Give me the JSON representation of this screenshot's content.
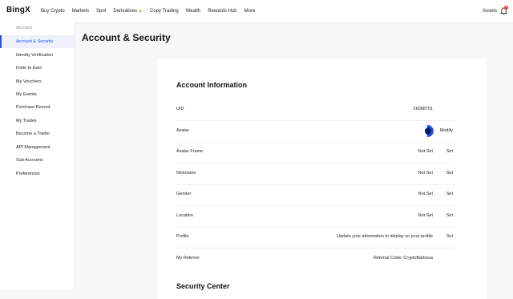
{
  "brand": {
    "logo_text": "BingX"
  },
  "nav": {
    "items": [
      "Buy Crypto",
      "Markets",
      "Spot",
      "Derivatives",
      "Copy Trading",
      "Wealth",
      "Rewards Hub",
      "More"
    ],
    "assets": "Assets",
    "notification_count": "1"
  },
  "sidebar": {
    "heading": "Account",
    "items": [
      "Account & Security",
      "Identity Verification",
      "Invite to Earn",
      "My Vouchers",
      "My Events",
      "Purchase Record",
      "My Trades",
      "Become a Trader",
      "API Management",
      "Sub Accounts",
      "Preferences"
    ],
    "active_index": 0
  },
  "page": {
    "title": "Account & Security"
  },
  "account_info": {
    "title": "Account Information",
    "rows": [
      {
        "label": "UID",
        "value": "26088701",
        "action": ""
      },
      {
        "label": "Avatar",
        "value": "",
        "action": "Modify"
      },
      {
        "label": "Avatar Frame",
        "value": "Not Set",
        "action": "Set"
      },
      {
        "label": "Nickname",
        "value": "Not Set",
        "action": "Set"
      },
      {
        "label": "Gender",
        "value": "Not Set",
        "action": "Set"
      },
      {
        "label": "Location",
        "value": "Not Set",
        "action": "Set"
      },
      {
        "label": "Profile",
        "value": "Update your information to display on your profile",
        "action": "Set"
      },
      {
        "label": "My Referrer",
        "value": "Referral Code: CryptoBarbosa",
        "action": ""
      }
    ]
  },
  "security_center": {
    "title": "Security Center"
  },
  "colors": {
    "accent": "#2354e6",
    "fire": "#f5a623"
  }
}
